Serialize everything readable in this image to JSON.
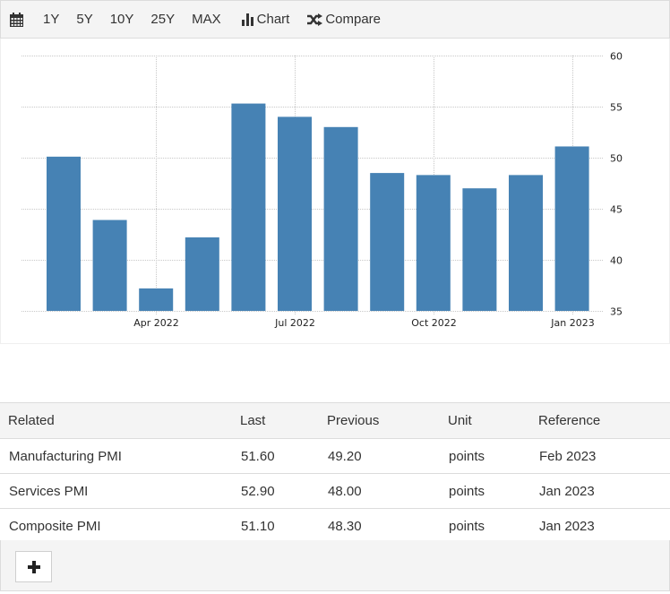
{
  "toolbar": {
    "calendar_icon": "calendar-icon",
    "ranges": [
      "1Y",
      "5Y",
      "10Y",
      "25Y",
      "MAX"
    ],
    "chart_label": "Chart",
    "chart_icon": "bar-chart-icon",
    "compare_label": "Compare",
    "compare_icon": "shuffle-icon"
  },
  "colors": {
    "bar": "#4682b4",
    "grid": "#c8c8c8",
    "panel_bg": "#f4f4f4",
    "border": "#dcdcdc"
  },
  "chart_data": {
    "type": "bar",
    "title": "",
    "xlabel": "",
    "ylabel": "",
    "categories": [
      "Feb 2022",
      "Mar 2022",
      "Apr 2022",
      "May 2022",
      "Jun 2022",
      "Jul 2022",
      "Aug 2022",
      "Sep 2022",
      "Oct 2022",
      "Nov 2022",
      "Dec 2022",
      "Jan 2023"
    ],
    "values": [
      50.1,
      43.9,
      37.2,
      42.2,
      55.3,
      54.0,
      53.0,
      48.5,
      48.3,
      47.0,
      48.3,
      51.1
    ],
    "ylim": [
      35,
      60
    ],
    "yticks": [
      60,
      55,
      50,
      45,
      40,
      35
    ],
    "xtick_labels": [
      {
        "label": "Apr 2022",
        "category": "Apr 2022"
      },
      {
        "label": "Jul 2022",
        "category": "Jul 2022"
      },
      {
        "label": "Oct 2022",
        "category": "Oct 2022"
      },
      {
        "label": "Jan 2023",
        "category": "Jan 2023"
      }
    ],
    "y_axis_position": "right",
    "grid": true,
    "legend": "none"
  },
  "table": {
    "headers": [
      "Related",
      "Last",
      "Previous",
      "Unit",
      "Reference"
    ],
    "rows": [
      [
        "Manufacturing PMI",
        "51.60",
        "49.20",
        "points",
        "Feb 2023"
      ],
      [
        "Services PMI",
        "52.90",
        "48.00",
        "points",
        "Jan 2023"
      ],
      [
        "Composite PMI",
        "51.10",
        "48.30",
        "points",
        "Jan 2023"
      ]
    ]
  },
  "footer": {
    "add_icon": "plus-icon"
  }
}
